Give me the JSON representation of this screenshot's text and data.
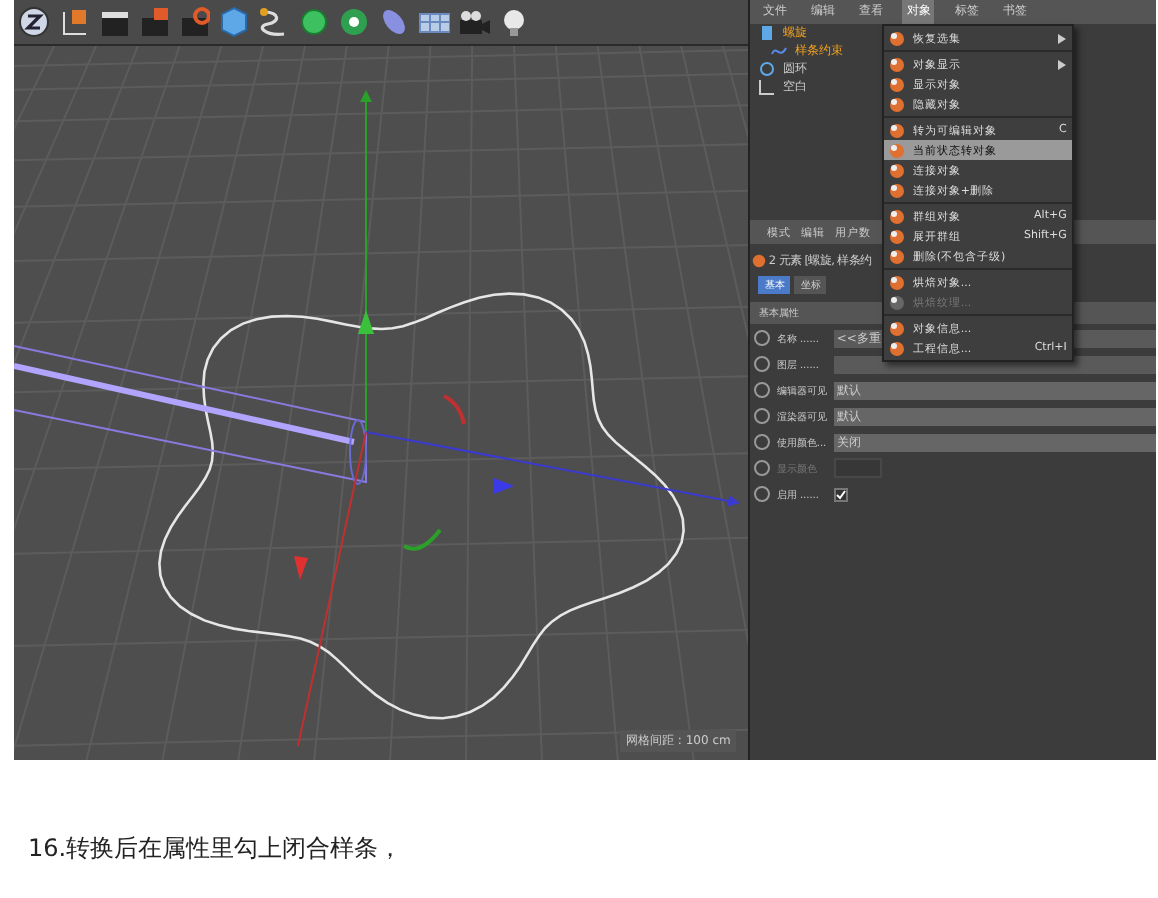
{
  "objects_manager": {
    "menu_bar": [
      {
        "label": "文件",
        "selected": false
      },
      {
        "label": "编辑",
        "selected": false
      },
      {
        "label": "查看",
        "selected": false
      },
      {
        "label": "对象",
        "selected": true
      },
      {
        "label": "标签",
        "selected": false
      },
      {
        "label": "书签",
        "selected": false
      }
    ],
    "tree": [
      {
        "name": "螺旋",
        "selected": true,
        "children": [
          {
            "name": "样条约束",
            "selected": true
          }
        ]
      },
      {
        "name": "圆环",
        "selected": false
      },
      {
        "name": "空白",
        "selected": false
      }
    ]
  },
  "object_menu": {
    "groups": [
      [
        {
          "label": "恢复选集",
          "submenu": true,
          "selected": false,
          "disabled": false
        }
      ],
      [
        {
          "label": "对象显示",
          "submenu": true,
          "selected": false,
          "disabled": false
        },
        {
          "label": "显示对象",
          "submenu": false,
          "selected": false,
          "disabled": false
        },
        {
          "label": "隐藏对象",
          "submenu": false,
          "selected": false,
          "disabled": false
        }
      ],
      [
        {
          "label": "转为可编辑对象",
          "shortcut": "C",
          "submenu": false,
          "selected": false,
          "disabled": false
        },
        {
          "label": "当前状态转对象",
          "submenu": false,
          "selected": true,
          "disabled": false
        },
        {
          "label": "连接对象",
          "submenu": false,
          "selected": false,
          "disabled": false
        },
        {
          "label": "连接对象+删除",
          "submenu": false,
          "selected": false,
          "disabled": false
        }
      ],
      [
        {
          "label": "群组对象",
          "shortcut": "Alt+G",
          "submenu": false,
          "selected": false,
          "disabled": false
        },
        {
          "label": "展开群组",
          "shortcut": "Shift+G",
          "submenu": false,
          "selected": false,
          "disabled": false
        },
        {
          "label": "删除(不包含子级)",
          "submenu": false,
          "selected": false,
          "disabled": false
        }
      ],
      [
        {
          "label": "烘焙对象...",
          "submenu": false,
          "selected": false,
          "disabled": false
        },
        {
          "label": "烘焙纹理...",
          "submenu": false,
          "selected": false,
          "disabled": true
        }
      ],
      [
        {
          "label": "对象信息...",
          "submenu": false,
          "selected": false,
          "disabled": false
        },
        {
          "label": "工程信息...",
          "shortcut": "Ctrl+I",
          "submenu": false,
          "selected": false,
          "disabled": false
        }
      ]
    ]
  },
  "attributes_manager": {
    "menu_bar": [
      "模式",
      "编辑",
      "用户数"
    ],
    "header": "2 元素 [螺旋, 样条约",
    "tabs": [
      {
        "label": "基本",
        "selected": true
      },
      {
        "label": "坐标",
        "selected": false
      }
    ],
    "section": "基本属性",
    "rows": [
      {
        "kind": "text",
        "label": "名称 ......",
        "value": "<<多重",
        "animated": false
      },
      {
        "kind": "text",
        "label": "图层 ......",
        "animated": false
      },
      {
        "kind": "dropdown",
        "label": "编辑器可见",
        "value": "默认",
        "animated": false
      },
      {
        "kind": "dropdown",
        "label": "渲染器可见",
        "value": "默认",
        "animated": false
      },
      {
        "kind": "dropdown",
        "label": "使用颜色...",
        "value": "关闭",
        "animated": false
      },
      {
        "kind": "color",
        "label": "显示颜色",
        "disabled": true,
        "animated": false
      },
      {
        "kind": "check",
        "label": "启用 ......",
        "checked": true,
        "animated": false
      }
    ]
  },
  "viewport": {
    "grid_label": "网格间距 : 100 cm"
  },
  "caption": "16.转换后在属性里勾上闭合样条，"
}
